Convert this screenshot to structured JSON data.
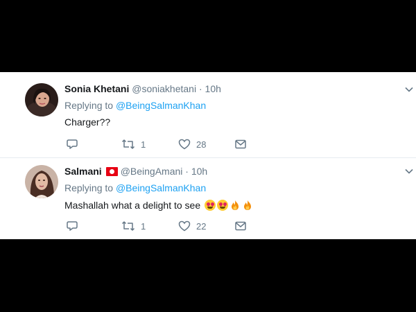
{
  "tweets": [
    {
      "name": "Sonia Khetani",
      "handle": "@soniakhetani",
      "separator": "·",
      "time": "10h",
      "reply_label": "Replying to",
      "reply_to": "@BeingSalmanKhan",
      "text": "Charger??",
      "emojis": [],
      "retweets": "1",
      "likes": "28",
      "flag": ""
    },
    {
      "name": "Salmani",
      "handle": "@BeingAmani",
      "separator": "·",
      "time": "10h",
      "reply_label": "Replying to",
      "reply_to": "@BeingSalmanKhan",
      "text": "Mashallah what a delight to see",
      "emojis": [
        "heart-eyes",
        "heart-eyes",
        "fire",
        "fire"
      ],
      "retweets": "1",
      "likes": "22",
      "flag": "tunisia-flag"
    }
  ],
  "colors": {
    "name": "#14171a",
    "muted": "#657786",
    "link": "#1da1f2",
    "background": "#000000",
    "panel": "#ffffff"
  },
  "icons": [
    "reply-icon",
    "retweet-icon",
    "like-icon",
    "direct-message-icon",
    "chevron-down-icon"
  ]
}
